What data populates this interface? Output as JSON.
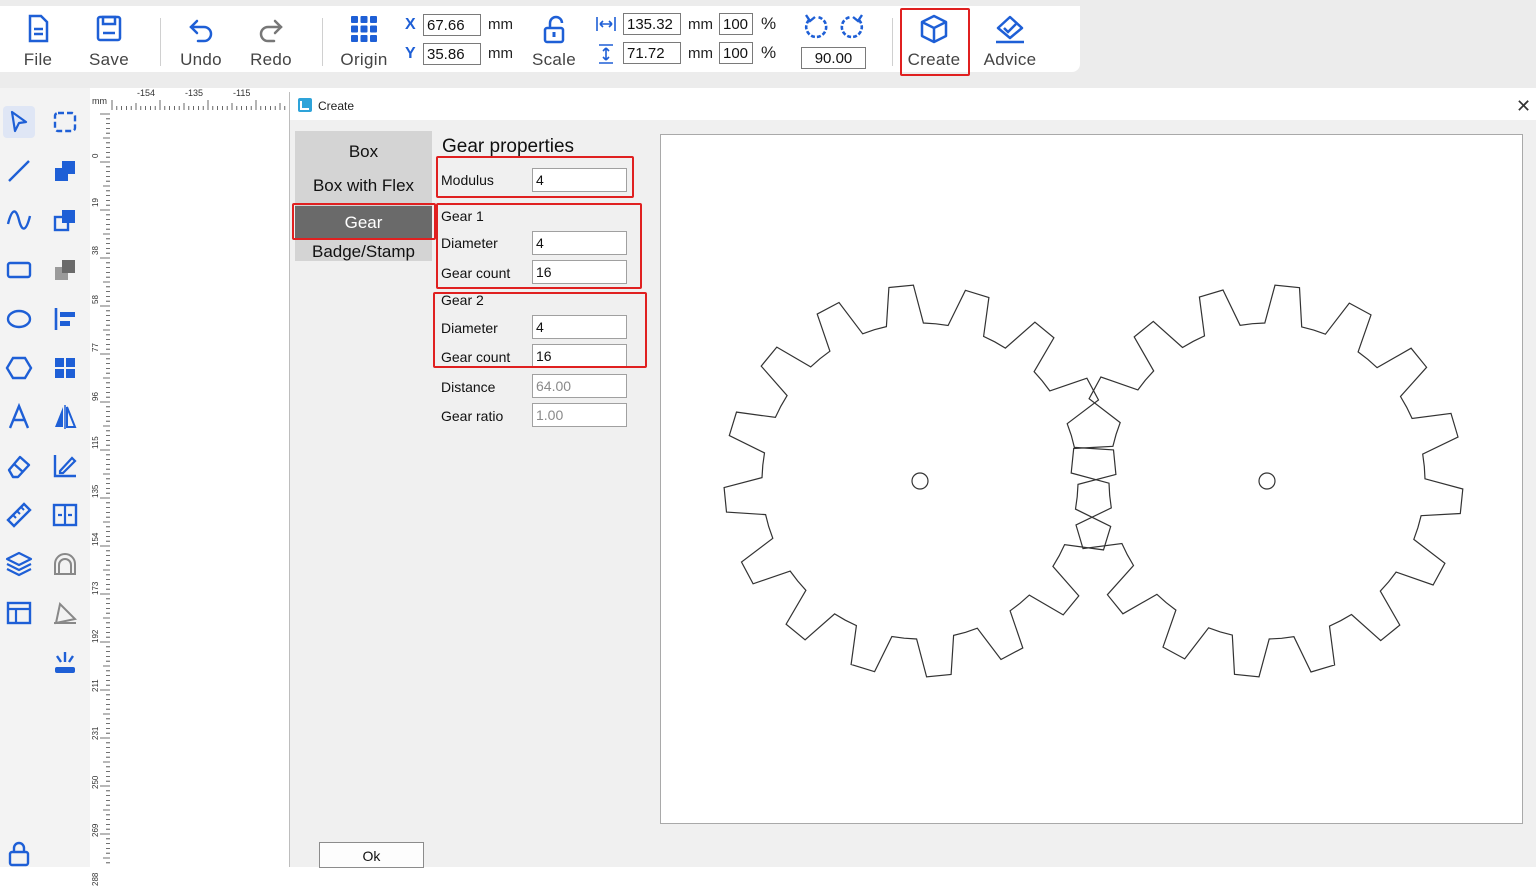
{
  "toolbar": {
    "file": "File",
    "save": "Save",
    "undo": "Undo",
    "redo": "Redo",
    "origin": "Origin",
    "x_label": "X",
    "y_label": "Y",
    "x_value": "67.66",
    "y_value": "35.86",
    "unit": "mm",
    "scale": "Scale",
    "width_value": "135.32",
    "height_value": "71.72",
    "width_pct": "100",
    "height_pct": "100",
    "pct": "%",
    "rotation": "90.00",
    "create": "Create",
    "advice": "Advice"
  },
  "ruler": {
    "unit": "mm",
    "top_ticks": [
      "-154",
      "-135",
      "-115"
    ],
    "left_ticks": [
      "0",
      "19",
      "38",
      "58",
      "77",
      "96",
      "115",
      "135",
      "154",
      "173",
      "192",
      "211",
      "231",
      "250",
      "269",
      "288"
    ]
  },
  "dialog": {
    "title": "Create",
    "close": "✕",
    "menu": [
      "Box",
      "Box with Flex",
      "Gear",
      "Badge/Stamp"
    ],
    "selected": "Gear",
    "group_title": "Gear properties",
    "modulus_label": "Modulus",
    "modulus": "4",
    "gear1_title": "Gear 1",
    "gear1_diameter_label": "Diameter",
    "gear1_diameter": "4",
    "gear1_count_label": "Gear count",
    "gear1_count": "16",
    "gear2_title": "Gear 2",
    "gear2_diameter_label": "Diameter",
    "gear2_diameter": "4",
    "gear2_count_label": "Gear count",
    "gear2_count": "16",
    "distance_label": "Distance",
    "distance": "64.00",
    "ratio_label": "Gear ratio",
    "ratio": "1.00",
    "ok": "Ok"
  },
  "colors": {
    "accent": "#1e5fd6",
    "highlight": "#e02020",
    "selected_menu": "#6a6a6a"
  },
  "icons": [
    "file-icon",
    "save-icon",
    "undo-icon",
    "redo-icon",
    "origin-grid-icon",
    "lock-icon",
    "width-icon",
    "height-icon",
    "rotate-ccw-icon",
    "rotate-cw-icon",
    "create-box-icon",
    "advice-icon"
  ]
}
